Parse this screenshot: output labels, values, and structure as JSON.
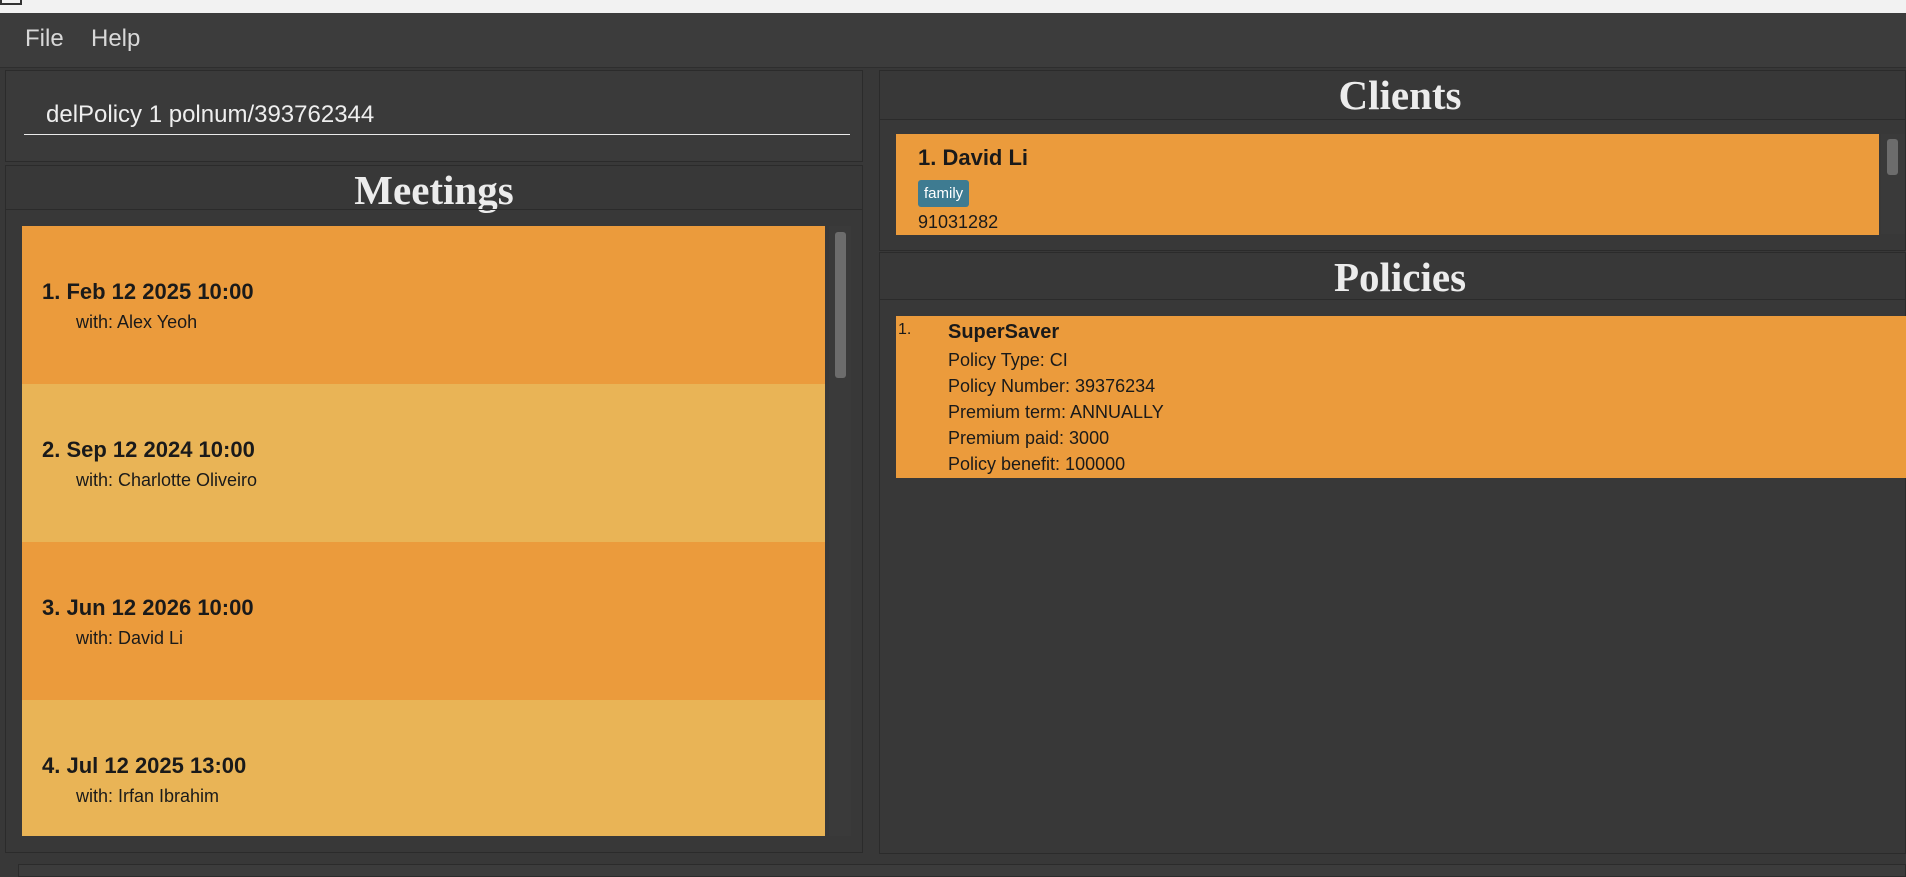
{
  "menu": {
    "file": "File",
    "help": "Help"
  },
  "command": {
    "value": "delPolicy 1 polnum/393762344"
  },
  "meetings": {
    "title": "Meetings",
    "items": [
      {
        "date": "1.  Feb 12 2025 10:00",
        "with": "with: Alex Yeoh",
        "color": "#eb9b3c"
      },
      {
        "date": "2.  Sep 12 2024 10:00",
        "with": "with: Charlotte Oliveiro",
        "color": "#e9b456"
      },
      {
        "date": "3.  Jun 12 2026 10:00",
        "with": "with: David Li",
        "color": "#eb9b3c"
      },
      {
        "date": "4.  Jul 12 2025 13:00",
        "with": "with: Irfan Ibrahim",
        "color": "#e9b456"
      }
    ]
  },
  "clients": {
    "title": "Clients",
    "items": [
      {
        "name": "1.  David Li",
        "tag": "family",
        "phone": "91031282"
      }
    ]
  },
  "policies": {
    "title": "Policies",
    "items": [
      {
        "index": "1.",
        "name": "SuperSaver",
        "type": "Policy Type: CI",
        "number": "Policy Number: 39376234",
        "term": "Premium term: ANNUALLY",
        "paid": "Premium paid: 3000",
        "benefit": "Policy benefit: 100000"
      }
    ]
  },
  "colors": {
    "accent": "#eb9b3c",
    "accent_alt": "#e9b456",
    "tag": "#3e7b91",
    "background": "#383838"
  }
}
